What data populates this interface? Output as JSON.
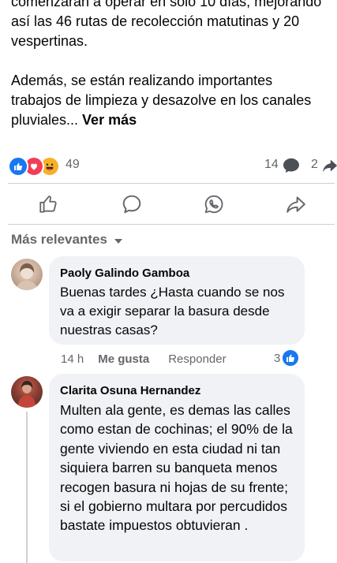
{
  "post": {
    "lines_top": "comenzarán a operar en solo 10 días, mejorando así las 46 rutas de recolección matutinas y 20 vespertinas.",
    "paragraph2": "Además, se están realizando importantes trabajos de limpieza y desazolve en los canales pluviales... ",
    "see_more": "Ver más"
  },
  "stats": {
    "reaction_count": "49",
    "comment_count": "14",
    "share_count": "2",
    "reaction_icons": [
      "like-icon",
      "love-icon",
      "haha-icon"
    ]
  },
  "actions": {
    "icons": [
      "thumbs-up-icon",
      "comment-icon",
      "whatsapp-icon",
      "share-icon"
    ]
  },
  "sort": {
    "label": "Más relevantes"
  },
  "comments": [
    {
      "author": "Paoly Galindo Gamboa",
      "text": "Buenas tardes ¿Hasta cuando se nos va a exigir separar la basura desde nuestras casas?",
      "time": "14 h",
      "like_label": "Me gusta",
      "reply_label": "Responder",
      "likes": "3"
    },
    {
      "author": "Clarita Osuna Hernandez",
      "text": "Multen ala gente, es demas las calles como estan de cochinas; el 90% de la gente viviendo en esta ciudad ni tan siquiera barren su banqueta menos recogen basura ni hojas de su frente; si el gobierno multara por percudidos bastate impuestos obtuvieran ."
    }
  ],
  "colors": {
    "accent": "#1877f2",
    "love": "#f33e58",
    "haha": "#f7b125",
    "secondary_text": "#65676b",
    "bubble_bg": "#f0f2f5"
  }
}
